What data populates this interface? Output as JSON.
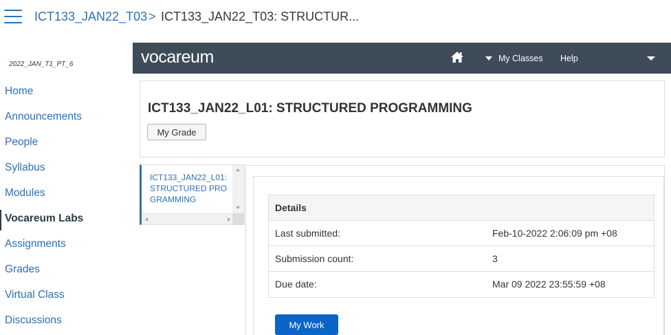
{
  "breadcrumb": {
    "course_link": "ICT133_JAN22_T03",
    "separator": ">",
    "current": "ICT133_JAN22_T03: STRUCTUR..."
  },
  "sidebar": {
    "course_code": "2022_JAN_T1_PT_6",
    "items": [
      {
        "label": "Home"
      },
      {
        "label": "Announcements"
      },
      {
        "label": "People"
      },
      {
        "label": "Syllabus"
      },
      {
        "label": "Modules"
      },
      {
        "label": "Vocareum Labs",
        "active": true
      },
      {
        "label": "Assignments"
      },
      {
        "label": "Grades"
      },
      {
        "label": "Virtual Class"
      },
      {
        "label": "Discussions"
      }
    ]
  },
  "vocareum": {
    "logo": "vocareum",
    "nav": {
      "home_icon": "home-icon",
      "my_classes": "My Classes",
      "help": "Help"
    },
    "header_color": "#3e4b58"
  },
  "course": {
    "title": "ICT133_JAN22_L01: STRUCTURED PROGRAMMING",
    "grade_button": "My Grade"
  },
  "assignments": {
    "items": [
      "ICT133_JAN22_L01: STRUCTURED PROGRAMMING"
    ]
  },
  "details": {
    "heading": "Details",
    "rows": [
      {
        "label": "Last submitted:",
        "value": "Feb-10-2022 2:06:09 pm +08"
      },
      {
        "label": "Submission count:",
        "value": "3"
      },
      {
        "label": "Due date:",
        "value": "Mar 09 2022 23:55:59 +08"
      }
    ],
    "work_button": "My Work"
  },
  "colors": {
    "link": "#2d6fb7",
    "primary_button": "#0b64c8"
  }
}
